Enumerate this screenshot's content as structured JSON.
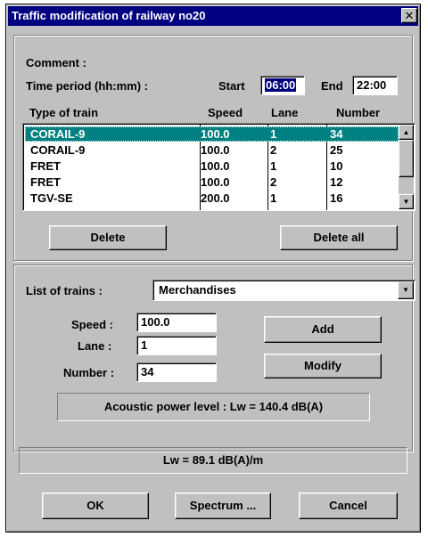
{
  "window": {
    "title": "Traffic modification of railway no20",
    "close_glyph": "✕"
  },
  "comment_label": "Comment :",
  "time_period": {
    "label": "Time period (hh:mm) :",
    "start_label": "Start",
    "start_value": "06:00",
    "end_label": "End",
    "end_value": "22:00"
  },
  "table": {
    "columns": [
      "Type of train",
      "Speed",
      "Lane",
      "Number"
    ],
    "rows": [
      {
        "type": "CORAIL-9",
        "speed": "100.0",
        "lane": "1",
        "number": "34",
        "selected": true
      },
      {
        "type": "CORAIL-9",
        "speed": "100.0",
        "lane": "2",
        "number": "25"
      },
      {
        "type": "FRET",
        "speed": "100.0",
        "lane": "1",
        "number": "10"
      },
      {
        "type": "FRET",
        "speed": "100.0",
        "lane": "2",
        "number": "12"
      },
      {
        "type": "TGV-SE",
        "speed": "200.0",
        "lane": "1",
        "number": "16"
      }
    ]
  },
  "buttons": {
    "delete": "Delete",
    "delete_all": "Delete all",
    "add": "Add",
    "modify": "Modify",
    "ok": "OK",
    "spectrum": "Spectrum ...",
    "cancel": "Cancel"
  },
  "train_list": {
    "label": "List of trains :",
    "selected": "Merchandises"
  },
  "form": {
    "speed_label": "Speed :",
    "speed_value": "100.0",
    "lane_label": "Lane :",
    "lane_value": "1",
    "number_label": "Number :",
    "number_value": "34"
  },
  "acoustic_power": "Acoustic power level :  Lw = 140.4 dB(A)",
  "lw_total": "Lw = 89.1 dB(A)/m",
  "icons": {
    "scroll_up": "▲",
    "scroll_down": "▼",
    "dropdown": "▼"
  },
  "colors": {
    "titlebar": "#000080",
    "face": "#c0c0c0",
    "selection": "#008080"
  }
}
